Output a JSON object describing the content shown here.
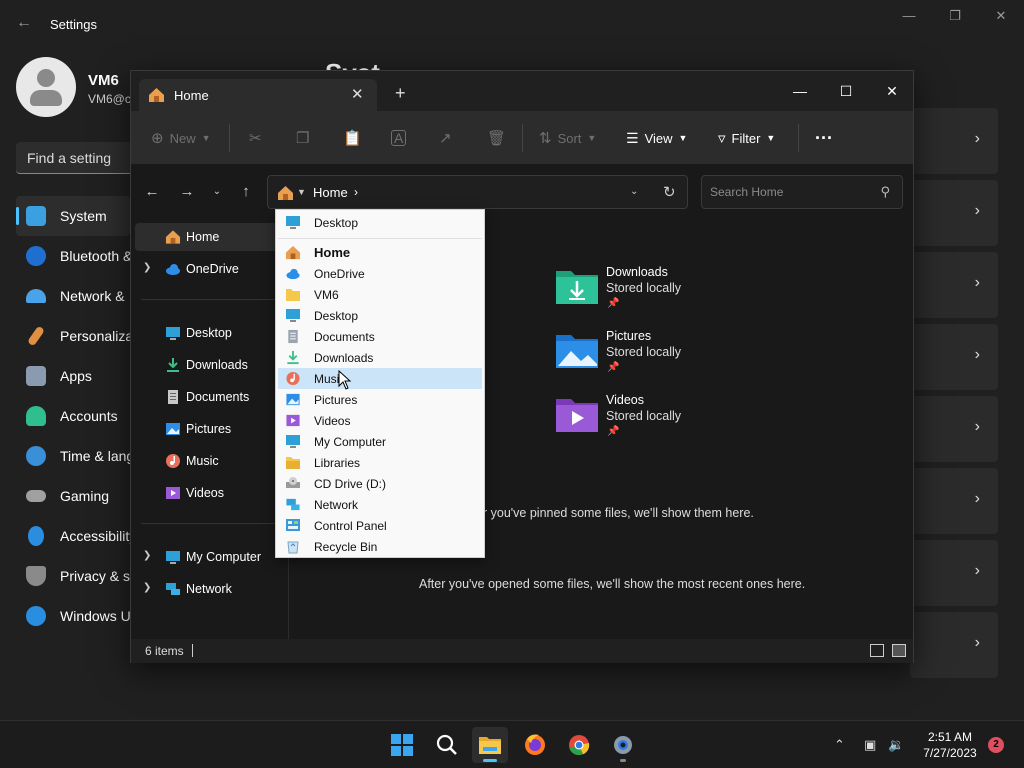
{
  "settings": {
    "title": "Settings",
    "user_name": "VM6",
    "user_email": "VM6@c",
    "search_placeholder": "Find a setting",
    "heading": "Syst",
    "nav": [
      {
        "label": "System"
      },
      {
        "label": "Bluetooth &"
      },
      {
        "label": "Network &"
      },
      {
        "label": "Personaliza"
      },
      {
        "label": "Apps"
      },
      {
        "label": "Accounts"
      },
      {
        "label": "Time & lang"
      },
      {
        "label": "Gaming"
      },
      {
        "label": "Accessibility"
      },
      {
        "label": "Privacy & se"
      },
      {
        "label": "Windows U"
      }
    ],
    "accent_color": "#4cc2ff"
  },
  "explorer": {
    "tab_label": "Home",
    "toolbar": {
      "new_label": "New",
      "sort_label": "Sort",
      "view_label": "View",
      "filter_label": "Filter",
      "more_label": "···"
    },
    "address": {
      "crumb": "Home"
    },
    "search_placeholder": "Search Home",
    "sidebar": {
      "home": "Home",
      "onedrive": "OneDrive",
      "pinned": [
        {
          "label": "Desktop"
        },
        {
          "label": "Downloads"
        },
        {
          "label": "Documents"
        },
        {
          "label": "Pictures"
        },
        {
          "label": "Music"
        },
        {
          "label": "Videos"
        }
      ],
      "my_computer": "My Computer",
      "network": "Network"
    },
    "quick_access": [
      {
        "name": "Downloads",
        "sub": "Stored locally"
      },
      {
        "name": "Pictures",
        "sub": "Stored locally"
      },
      {
        "name": "Videos",
        "sub": "Stored locally"
      }
    ],
    "pinned_msg": "r you've pinned some files, we'll show them here.",
    "recent_msg": "After you've opened some files, we'll show the most recent ones here.",
    "status_count": "6 items"
  },
  "menu": {
    "top": "Desktop",
    "items": [
      {
        "label": "Home"
      },
      {
        "label": "OneDrive"
      },
      {
        "label": "VM6"
      },
      {
        "label": "Desktop"
      },
      {
        "label": "Documents"
      },
      {
        "label": "Downloads"
      },
      {
        "label": "Music"
      },
      {
        "label": "Pictures"
      },
      {
        "label": "Videos"
      },
      {
        "label": "My Computer"
      },
      {
        "label": "Libraries"
      },
      {
        "label": "CD Drive (D:)"
      },
      {
        "label": "Network"
      },
      {
        "label": "Control Panel"
      },
      {
        "label": "Recycle Bin"
      }
    ],
    "highlight_color": "#cce4f7"
  },
  "taskbar": {
    "time": "2:51 AM",
    "date": "7/27/2023",
    "notification_count": "2"
  }
}
